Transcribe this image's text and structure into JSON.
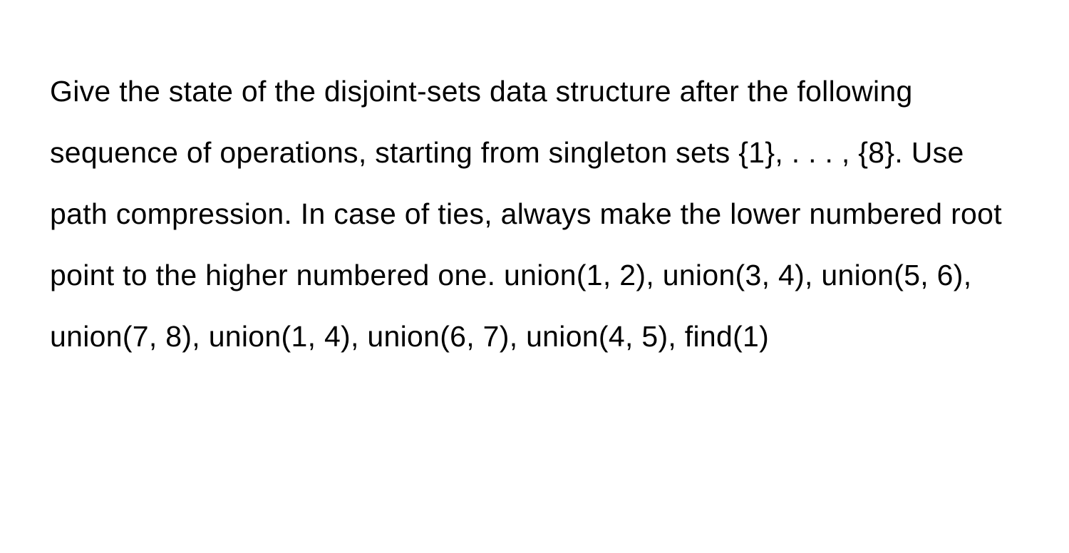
{
  "problem": {
    "text": "Give the state of the disjoint-sets data structure after the following sequence of operations, starting from singleton sets {1}, . . . , {8}. Use path compression. In case of ties, always make the lower numbered root point to the higher numbered one. union(1, 2), union(3, 4), union(5, 6), union(7, 8), union(1, 4), union(6, 7), union(4, 5), find(1)"
  }
}
